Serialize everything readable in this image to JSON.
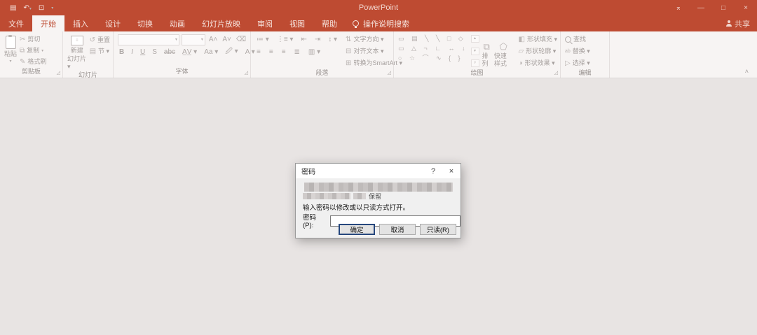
{
  "colors": {
    "titlebar": "#BE4B32",
    "active_tab_text": "#BE4B32",
    "ribbon_bg": "#F7F4F3",
    "workspace_bg": "#E8E4E3",
    "dialog_bg": "#F0F0F0",
    "focus_button_border": "#26477D"
  },
  "window": {
    "title": "PowerPoint",
    "minimize": "—",
    "maximize": "□",
    "close": "×",
    "ribbon_display_icon": "⌅"
  },
  "qat": {
    "save_icon": "▤",
    "undo_icon": "↶",
    "undo_dd": "▾",
    "slideshow_icon": "⊡",
    "more_icon": "▾"
  },
  "tabs": {
    "file": "文件",
    "items": [
      "开始",
      "插入",
      "设计",
      "切换",
      "动画",
      "幻灯片放映",
      "审阅",
      "视图",
      "帮助"
    ],
    "active": "开始",
    "tell_me": "操作说明搜索",
    "share": "共享"
  },
  "ribbon": {
    "clipboard": {
      "label": "剪贴板",
      "paste": "粘贴",
      "paste_dd": "▾",
      "cut": "剪切",
      "copy": "复制",
      "format_painter": "格式刷",
      "cut_icon": "✂",
      "copy_icon": "⧉",
      "painter_icon": "✎"
    },
    "slides": {
      "label": "幻灯片",
      "new_slide_l1": "新建",
      "new_slide_l2": "幻灯片 ▾",
      "reset": "重置",
      "section": "节 ▾",
      "reset_icon": "↺"
    },
    "font": {
      "label": "字体",
      "grow": "A˄",
      "shrink": "A˅",
      "clear_icon": "⌫",
      "bold": "B",
      "italic": "I",
      "underline": "U",
      "shadow": "S",
      "strike": "abc",
      "spacing": "A̲V̲ ▾",
      "case": "Aa ▾",
      "highlight": "🖉 ▾",
      "color": "A ▾",
      "combo_dd": "▾"
    },
    "paragraph": {
      "label": "段落",
      "bullets": "≔ ▾",
      "numbering": "⋮≡ ▾",
      "indent_dec": "⇤",
      "indent_inc": "⇥",
      "spacing": "↕ ▾",
      "align_left": "≡",
      "align_center": "≡",
      "align_right": "≡",
      "justify": "≣",
      "columns": "▥ ▾",
      "text_direction": "文字方向 ▾",
      "align_text": "对齐文本 ▾",
      "smartart": "转换为SmartArt ▾",
      "dir_icon": "⇅",
      "at_icon": "⊟",
      "sa_icon": "⊞"
    },
    "drawing": {
      "label": "绘图",
      "shapes_row1": "▭ ▤ ╲ ╲ □ ◇",
      "shapes_row2": "▭ △ ¬ ∟ ↔ ↓",
      "shapes_row3": "○ ☆ ⌒ ∿ { }",
      "up": "▴",
      "down": "▾",
      "more": "▿",
      "arrange": "排列",
      "quick_styles": "快速样式",
      "shape_fill": "形状填充 ▾",
      "shape_outline": "形状轮廓 ▾",
      "shape_effects": "形状效果 ▾",
      "arrange_icon": "⧉",
      "qs_icon": "⬠",
      "fill_icon": "◧",
      "outline_icon": "▱",
      "effects_icon": "◑"
    },
    "editing": {
      "label": "编辑",
      "find": "查找",
      "replace": "替换 ▾",
      "select": "选择 ▾",
      "replace_icon": "ab",
      "select_icon": "▷"
    },
    "collapse": "˄"
  },
  "dialog": {
    "title": "密码",
    "help": "?",
    "close": "×",
    "redacted_fragment": "保留",
    "prompt": "输入密码以修改或以只读方式打开。",
    "password_label": "密码(P):",
    "password_value": "",
    "ok": "确定",
    "cancel": "取消",
    "readonly": "只读(R)"
  }
}
